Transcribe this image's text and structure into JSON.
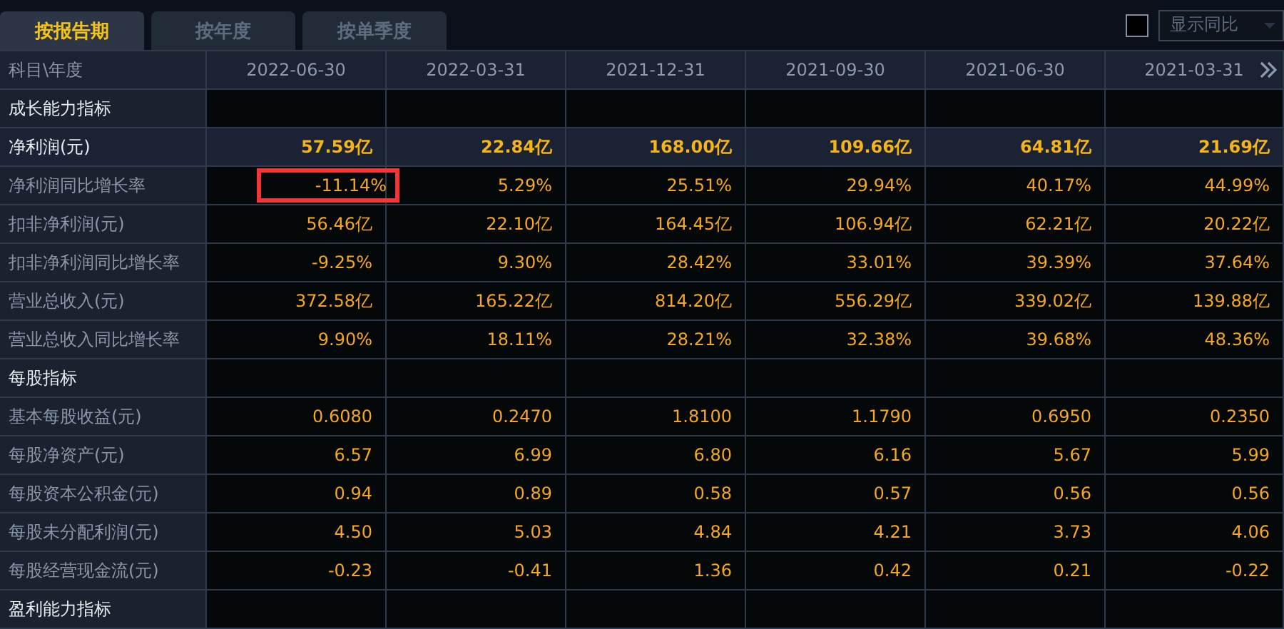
{
  "tabs": [
    {
      "label": "按报告期",
      "selected": true
    },
    {
      "label": "按年度",
      "selected": false
    },
    {
      "label": "按单季度",
      "selected": false
    }
  ],
  "compare": {
    "checked": false,
    "dropdown": "显示同比"
  },
  "table": {
    "columns": [
      "科目\\年度",
      "2022-06-30",
      "2022-03-31",
      "2021-12-31",
      "2021-09-30",
      "2021-06-30",
      "2021-03-31"
    ],
    "rows": [
      {
        "kind": "section",
        "label": "成长能力指标",
        "cells": []
      },
      {
        "kind": "key",
        "label": "净利润(元)",
        "cells": [
          {
            "text": "57.59亿",
            "boxed": false
          },
          {
            "text": "22.84亿",
            "boxed": false
          },
          {
            "text": "168.00亿",
            "boxed": false
          },
          {
            "text": "109.66亿",
            "boxed": false
          },
          {
            "text": "64.81亿",
            "boxed": false
          },
          {
            "text": "21.69亿",
            "boxed": false
          }
        ]
      },
      {
        "kind": "normal",
        "label": "净利润同比增长率",
        "cells": [
          {
            "text": "-11.14%",
            "boxed": true
          },
          {
            "text": "5.29%",
            "boxed": false
          },
          {
            "text": "25.51%",
            "boxed": false
          },
          {
            "text": "29.94%",
            "boxed": false
          },
          {
            "text": "40.17%",
            "boxed": false
          },
          {
            "text": "44.99%",
            "boxed": false
          }
        ]
      },
      {
        "kind": "normal",
        "label": "扣非净利润(元)",
        "cells": [
          {
            "text": "56.46亿",
            "boxed": false
          },
          {
            "text": "22.10亿",
            "boxed": false
          },
          {
            "text": "164.45亿",
            "boxed": false
          },
          {
            "text": "106.94亿",
            "boxed": false
          },
          {
            "text": "62.21亿",
            "boxed": false
          },
          {
            "text": "20.22亿",
            "boxed": false
          }
        ]
      },
      {
        "kind": "normal",
        "label": "扣非净利润同比增长率",
        "cells": [
          {
            "text": "-9.25%",
            "boxed": false
          },
          {
            "text": "9.30%",
            "boxed": false
          },
          {
            "text": "28.42%",
            "boxed": false
          },
          {
            "text": "33.01%",
            "boxed": false
          },
          {
            "text": "39.39%",
            "boxed": false
          },
          {
            "text": "37.64%",
            "boxed": false
          }
        ]
      },
      {
        "kind": "normal",
        "label": "营业总收入(元)",
        "cells": [
          {
            "text": "372.58亿",
            "boxed": false
          },
          {
            "text": "165.22亿",
            "boxed": false
          },
          {
            "text": "814.20亿",
            "boxed": false
          },
          {
            "text": "556.29亿",
            "boxed": false
          },
          {
            "text": "339.02亿",
            "boxed": false
          },
          {
            "text": "139.88亿",
            "boxed": false
          }
        ]
      },
      {
        "kind": "normal",
        "label": "营业总收入同比增长率",
        "cells": [
          {
            "text": "9.90%",
            "boxed": false
          },
          {
            "text": "18.11%",
            "boxed": false
          },
          {
            "text": "28.21%",
            "boxed": false
          },
          {
            "text": "32.38%",
            "boxed": false
          },
          {
            "text": "39.68%",
            "boxed": false
          },
          {
            "text": "48.36%",
            "boxed": false
          }
        ]
      },
      {
        "kind": "section",
        "label": "每股指标",
        "cells": []
      },
      {
        "kind": "normal",
        "label": "基本每股收益(元)",
        "cells": [
          {
            "text": "0.6080",
            "boxed": false
          },
          {
            "text": "0.2470",
            "boxed": false
          },
          {
            "text": "1.8100",
            "boxed": false
          },
          {
            "text": "1.1790",
            "boxed": false
          },
          {
            "text": "0.6950",
            "boxed": false
          },
          {
            "text": "0.2350",
            "boxed": false
          }
        ]
      },
      {
        "kind": "normal",
        "label": "每股净资产(元)",
        "cells": [
          {
            "text": "6.57",
            "boxed": false
          },
          {
            "text": "6.99",
            "boxed": false
          },
          {
            "text": "6.80",
            "boxed": false
          },
          {
            "text": "6.16",
            "boxed": false
          },
          {
            "text": "5.67",
            "boxed": false
          },
          {
            "text": "5.99",
            "boxed": false
          }
        ]
      },
      {
        "kind": "normal",
        "label": "每股资本公积金(元)",
        "cells": [
          {
            "text": "0.94",
            "boxed": false
          },
          {
            "text": "0.89",
            "boxed": false
          },
          {
            "text": "0.58",
            "boxed": false
          },
          {
            "text": "0.57",
            "boxed": false
          },
          {
            "text": "0.56",
            "boxed": false
          },
          {
            "text": "0.56",
            "boxed": false
          }
        ]
      },
      {
        "kind": "normal",
        "label": "每股未分配利润(元)",
        "cells": [
          {
            "text": "4.50",
            "boxed": false
          },
          {
            "text": "5.03",
            "boxed": false
          },
          {
            "text": "4.84",
            "boxed": false
          },
          {
            "text": "4.21",
            "boxed": false
          },
          {
            "text": "3.73",
            "boxed": false
          },
          {
            "text": "4.06",
            "boxed": false
          }
        ]
      },
      {
        "kind": "normal",
        "label": "每股经营现金流(元)",
        "cells": [
          {
            "text": "-0.23",
            "boxed": false
          },
          {
            "text": "-0.41",
            "boxed": false
          },
          {
            "text": "1.36",
            "boxed": false
          },
          {
            "text": "0.42",
            "boxed": false
          },
          {
            "text": "0.21",
            "boxed": false
          },
          {
            "text": "-0.22",
            "boxed": false
          }
        ]
      },
      {
        "kind": "section",
        "label": "盈利能力指标",
        "cells": []
      }
    ]
  }
}
